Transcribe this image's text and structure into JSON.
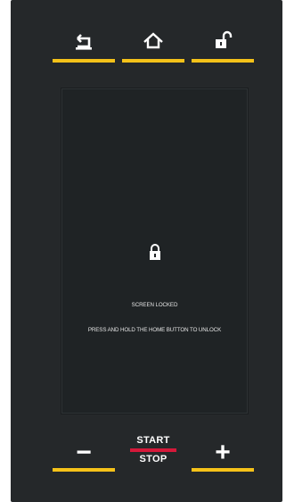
{
  "controls": {
    "back": {
      "icon": "back-arrow-icon"
    },
    "home": {
      "icon": "home-icon"
    },
    "lock": {
      "icon": "unlock-icon"
    }
  },
  "screen": {
    "icon": "padlock-icon",
    "locked_text": "SCREEN LOCKED",
    "instruction_text": "PRESS AND HOLD THE HOME BUTTON TO UNLOCK"
  },
  "bottom": {
    "minus_label": "−",
    "plus_label": "+",
    "start_label": "START",
    "stop_label": "STOP"
  },
  "colors": {
    "accent_yellow": "#f5c219",
    "accent_red": "#d6193a",
    "panel_bg": "#25282a",
    "screen_bg": "#1f2325"
  }
}
